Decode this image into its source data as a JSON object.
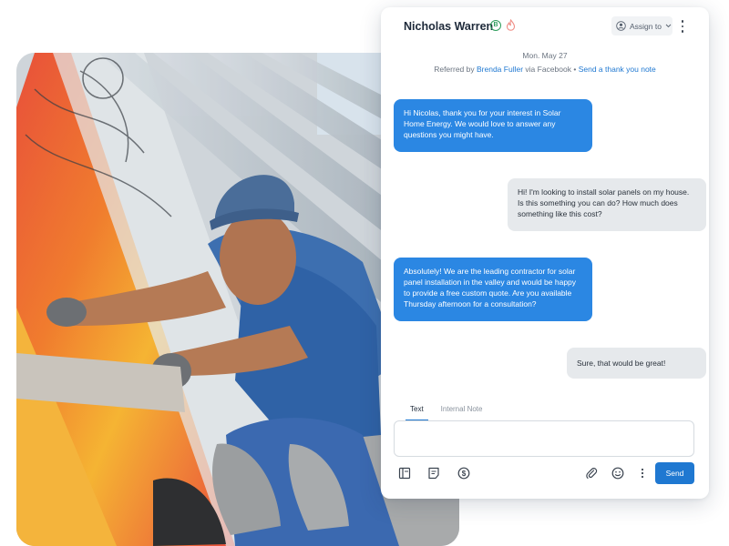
{
  "photo": {
    "alt": "Solar installer working on rooftop panels"
  },
  "chat": {
    "contact_name": "Nicholas Warren",
    "badge_letter": "B",
    "assign_label": "Assign to",
    "date": "Mon. May 27",
    "referral": {
      "prefix": "Referred by",
      "referrer": "Brenda Fuller",
      "via": "via Facebook",
      "separator": "•",
      "action": "Send a thank you note"
    },
    "messages": [
      {
        "direction": "outgoing",
        "text": "Hi Nicolas, thank you for your interest in Solar Home Energy. We would love to answer any questions you might have."
      },
      {
        "direction": "incoming",
        "text": "Hi! I'm looking to install solar panels on my house. Is this something you can do? How much does something like this cost?"
      },
      {
        "direction": "outgoing",
        "text": "Absolutely! We are the leading contractor for solar panel installation in the valley and would be happy to provide a free custom quote. Are you available Thursday afternoon for a consultation?"
      },
      {
        "direction": "incoming",
        "text": "Sure, that would be great!"
      }
    ],
    "composer": {
      "tabs": [
        {
          "label": "Text",
          "active": true
        },
        {
          "label": "Internal Note",
          "active": false
        }
      ],
      "value": "",
      "send_label": "Send"
    },
    "icons": {
      "left": [
        "template-icon",
        "note-icon",
        "payment-icon"
      ],
      "right": [
        "attachment-icon",
        "emoji-icon",
        "more-options-icon"
      ]
    },
    "colors": {
      "accent": "#1f78d1",
      "outgoing_bubble": "#2b87e3",
      "incoming_bubble": "#e6e9ec",
      "badge_green": "#2f9e5d"
    }
  }
}
